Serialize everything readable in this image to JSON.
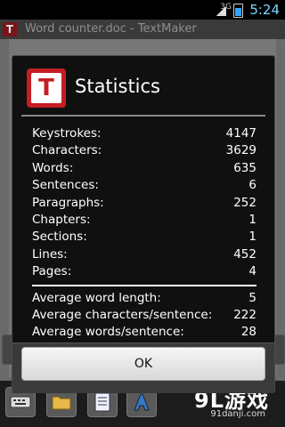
{
  "status_bar": {
    "network": "3G",
    "time": "5:24"
  },
  "app": {
    "title": "Word counter.doc - TextMaker",
    "logo_letter": "T"
  },
  "dialog": {
    "title": "Statistics",
    "icon_letter": "T",
    "stats": [
      {
        "label": "Keystrokes:",
        "value": "4147"
      },
      {
        "label": "Characters:",
        "value": "3629"
      },
      {
        "label": "Words:",
        "value": "635"
      },
      {
        "label": "Sentences:",
        "value": "6"
      },
      {
        "label": "Paragraphs:",
        "value": "252"
      },
      {
        "label": "Chapters:",
        "value": "1"
      },
      {
        "label": "Sections:",
        "value": "1"
      },
      {
        "label": "Lines:",
        "value": "452"
      },
      {
        "label": "Pages:",
        "value": "4"
      }
    ],
    "averages": [
      {
        "label": "Average word length:",
        "value": "5"
      },
      {
        "label": "Average characters/sentence:",
        "value": "222"
      },
      {
        "label": "Average words/sentence:",
        "value": "28"
      }
    ],
    "ok_label": "OK"
  },
  "toolbar": {
    "icons": [
      "keyboard-icon",
      "folder-icon",
      "document-icon",
      "text-format-icon"
    ]
  },
  "watermark": {
    "main": "9L游戏",
    "sub": "91danji.com"
  },
  "colors": {
    "brand_red": "#c41e24",
    "accent_blue": "#2fa3ff"
  }
}
